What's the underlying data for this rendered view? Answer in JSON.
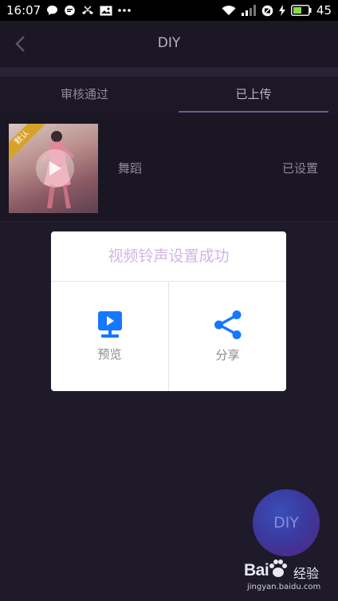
{
  "status_bar": {
    "time": "16:07",
    "left_icons": [
      "chat-bubble-icon",
      "chat-bubble-icon",
      "missed-call-icon",
      "mail-icon",
      "more-dots-icon"
    ],
    "right_icons": [
      "wifi-icon",
      "signal-icon",
      "no-sim-icon",
      "charging-icon",
      "battery-icon"
    ],
    "battery_level": "45",
    "battery_color": "#7ee04a"
  },
  "header": {
    "title": "DIY",
    "back_icon": "chevron-left-icon"
  },
  "tabs": [
    {
      "label": "审核通过",
      "active": false
    },
    {
      "label": "已上传",
      "active": true
    }
  ],
  "list": {
    "items": [
      {
        "badge": "默认",
        "name": "舞蹈",
        "status": "已设置"
      }
    ]
  },
  "dialog": {
    "title": "视频铃声设置成功",
    "actions": [
      {
        "label": "预览",
        "icon": "preview-monitor-icon"
      },
      {
        "label": "分享",
        "icon": "share-icon"
      }
    ],
    "accent_color": "#1677ff",
    "title_color": "#d4b3e6"
  },
  "fab": {
    "label": "DIY"
  },
  "watermark": {
    "brand": "Bai",
    "brand_suffix": "经验",
    "url": "jingyan.baidu.com"
  }
}
